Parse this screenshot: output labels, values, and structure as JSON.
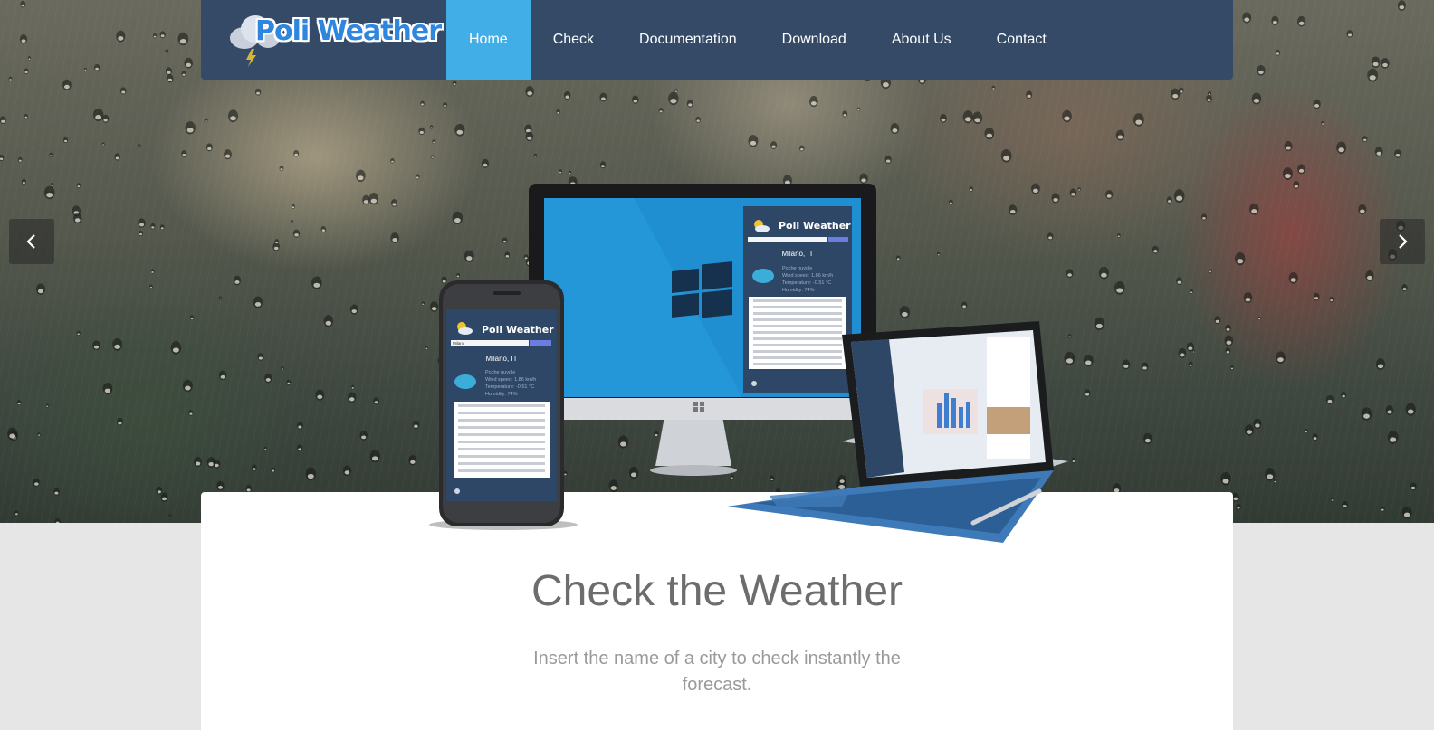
{
  "brand": {
    "name": "Poli Weather"
  },
  "nav": {
    "items": [
      {
        "label": "Home",
        "active": true
      },
      {
        "label": "Check",
        "active": false
      },
      {
        "label": "Documentation",
        "active": false
      },
      {
        "label": "Download",
        "active": false
      },
      {
        "label": "About Us",
        "active": false
      },
      {
        "label": "Contact",
        "active": false
      }
    ]
  },
  "carousel": {
    "prev_icon": "chevron-left-icon",
    "next_icon": "chevron-right-icon"
  },
  "device_app": {
    "brand": "Poli Weather",
    "search_value": "Milano",
    "city": "Milano, IT",
    "conditions": [
      "Poche nuvole",
      "Wind speed: 1.86 km/h",
      "Temperature: -0.51 °C",
      "Humidity: 74%"
    ]
  },
  "hero_card": {
    "title": "Check the Weather",
    "subtitle": "Insert the name of a city to check instantly the forecast."
  },
  "colors": {
    "navbar": "#344a67",
    "nav_active": "#42aee8",
    "page_background": "#e6e6e6",
    "title_text": "#6d6d6d",
    "subtitle_text": "#9a9a9a"
  }
}
